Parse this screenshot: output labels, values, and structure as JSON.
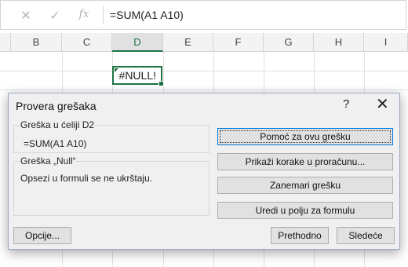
{
  "formula_bar": {
    "cancel_icon": "close-icon",
    "enter_icon": "checkmark-icon",
    "fx_label": "fx",
    "formula": "=SUM(A1 A10)"
  },
  "sheet": {
    "columns": [
      "B",
      "C",
      "D",
      "E",
      "F",
      "G",
      "H",
      "I"
    ],
    "active_column": "D",
    "active_cell_value": "#NULL!",
    "error_indicator_color": "#217346"
  },
  "dialog": {
    "title": "Provera grešaka",
    "help_label": "?",
    "close_label": "✕",
    "cell_group_title": "Greška u ćeliji D2",
    "cell_formula": "=SUM(A1 A10)",
    "error_group_title": "Greška „Null“",
    "error_description": "Opsezi u formuli se ne ukrštaju.",
    "buttons": {
      "help_on_error": "Pomoć za ovu grešku",
      "show_calc_steps": "Prikaži korake u proračunu...",
      "ignore_error": "Zanemari grešku",
      "edit_in_formula_bar": "Uredi u polju za formulu",
      "options": "Opcije...",
      "previous": "Prethodno",
      "next": "Sledeće"
    }
  }
}
